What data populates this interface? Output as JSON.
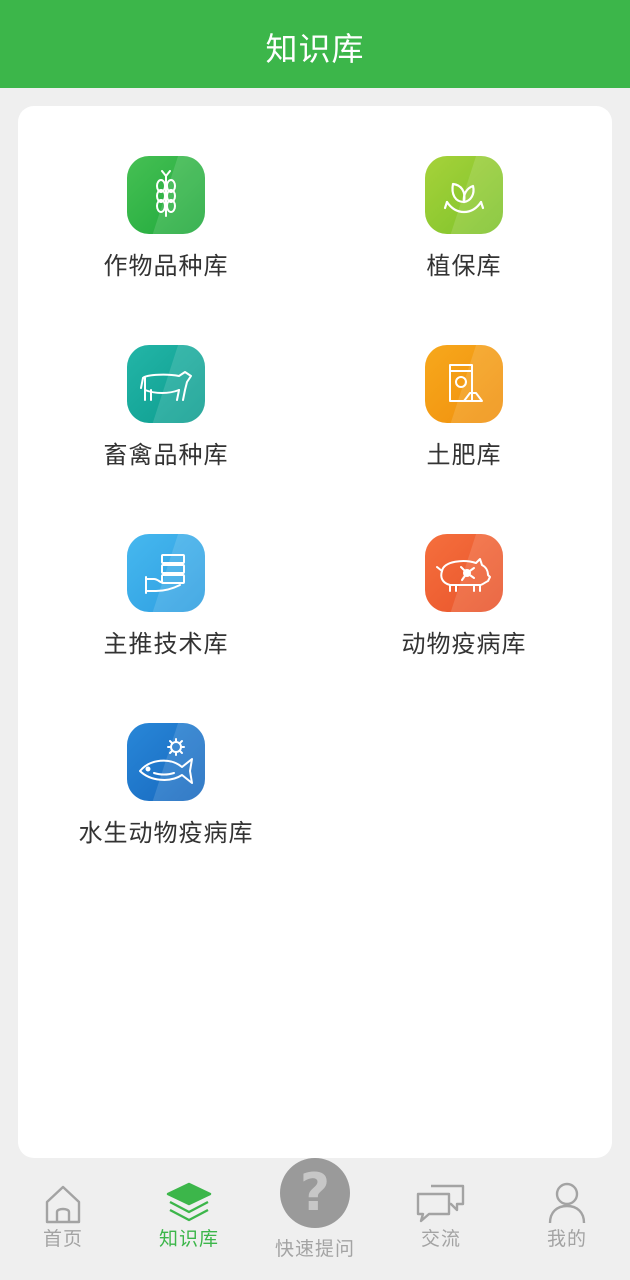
{
  "header": {
    "title": "知识库"
  },
  "library": {
    "items": [
      {
        "label": "作物品种库",
        "icon": "wheat-icon",
        "color": "#2eb045"
      },
      {
        "label": "植保库",
        "icon": "leaf-hand-icon",
        "color": "#8ec830"
      },
      {
        "label": "畜禽品种库",
        "icon": "cow-icon",
        "color": "#16a99a"
      },
      {
        "label": "土肥库",
        "icon": "fertilizer-bag-icon",
        "color": "#f39a14"
      },
      {
        "label": "主推技术库",
        "icon": "hand-server-icon",
        "color": "#36a9e6"
      },
      {
        "label": "动物疫病库",
        "icon": "pig-virus-icon",
        "color": "#ee6034"
      },
      {
        "label": "水生动物疫病库",
        "icon": "fish-virus-icon",
        "color": "#1e77cc"
      }
    ]
  },
  "tabbar": {
    "tabs": [
      {
        "label": "首页",
        "icon": "home-icon"
      },
      {
        "label": "知识库",
        "icon": "layers-icon"
      },
      {
        "label": "快速提问",
        "icon": "question-icon"
      },
      {
        "label": "交流",
        "icon": "chat-bubbles-icon"
      },
      {
        "label": "我的",
        "icon": "user-icon"
      }
    ],
    "active_color": "#3cb64a",
    "inactive_color": "#a3a3a3"
  }
}
